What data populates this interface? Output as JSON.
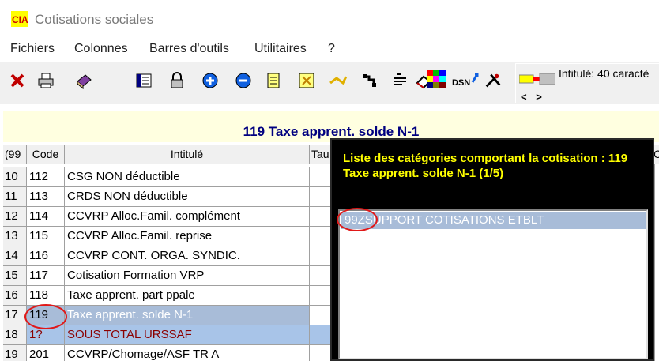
{
  "window": {
    "title": "Cotisations sociales",
    "app_icon_text": "CIA"
  },
  "menu": [
    "Fichiers",
    "Colonnes",
    "Barres d'outils",
    "Utilitaires",
    "?"
  ],
  "toolbar": {
    "icons": [
      "close-icon",
      "print-icon",
      "book-icon",
      "columns-icon",
      "lock-icon",
      "plus-circle-icon",
      "minus-circle-icon",
      "notes-icon",
      "formula-icon",
      "scissors-icon",
      "link-icon",
      "pen-icon",
      "eraser-icon",
      "palette-icon",
      "dsn-icon",
      "tools-icon"
    ],
    "dsn_label": "DSN",
    "intitule_label": "Intitulé: 40 caractè",
    "nav_arrows": "< >"
  },
  "header_title": "119 Taxe apprent. solde N-1",
  "grid": {
    "columns": {
      "num": "(99",
      "code": "Code",
      "intitule": "Intitulé",
      "taux": "Tau"
    },
    "right_header": "C",
    "rows": [
      {
        "num": "10",
        "code": "112",
        "intitule": "CSG NON déductible"
      },
      {
        "num": "11",
        "code": "113",
        "intitule": "CRDS NON déductible"
      },
      {
        "num": "12",
        "code": "114",
        "intitule": "CCVRP Alloc.Famil. complément"
      },
      {
        "num": "13",
        "code": "115",
        "intitule": "CCVRP Alloc.Famil. reprise"
      },
      {
        "num": "14",
        "code": "116",
        "intitule": "CCVRP CONT. ORGA. SYNDIC."
      },
      {
        "num": "15",
        "code": "117",
        "intitule": "Cotisation Formation VRP"
      },
      {
        "num": "16",
        "code": "118",
        "intitule": "Taxe apprent. part ppale"
      },
      {
        "num": "17",
        "code": "119",
        "intitule": "Taxe apprent. solde N-1"
      },
      {
        "num": "18",
        "code": "1?",
        "intitule": "SOUS TOTAL URSSAF"
      },
      {
        "num": "19",
        "code": "201",
        "intitule": "CCVRP/Chomage/ASF TR A"
      }
    ]
  },
  "popup": {
    "title": "Liste des catégories comportant la cotisation : 119 Taxe apprent. solde N-1 (1/5)",
    "items": [
      {
        "code": "99Z",
        "label": "SUPPORT COTISATIONS ETBLT"
      }
    ]
  },
  "colors": {
    "accent_header": "#000080",
    "selection": "#a8bcd8",
    "annotation": "#e01818",
    "popup_title": "#ffff00"
  }
}
